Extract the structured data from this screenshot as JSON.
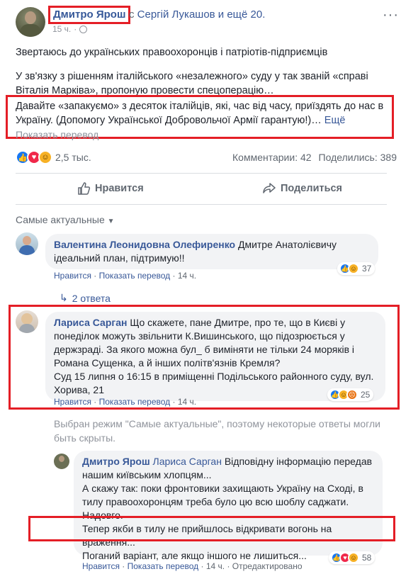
{
  "post": {
    "author": "Дмитро Ярош",
    "with_text": "с",
    "with_people": "Сергій Лукашов и ещё 20.",
    "time": "15 ч.",
    "more_menu": "···",
    "p1": "Звертаюсь до українських правоохоронців і патріотів-підприємців",
    "p2": "У зв'язку з рішенням італійського «незалежного» суду у так званій «справі Віталія Марківа», пропоную провести спецоперацію…",
    "p3": "Давайте «запакуємо» з десяток італійців, які, час від часу, приїздять до нас в Україну. (Допомогу Української Добровольчої Армії гарантую!)…",
    "p3_more": "Ещё",
    "translate": "Показать перевод",
    "reactions_count": "2,5 тыс.",
    "comments_count": "Комментарии: 42",
    "shares_count": "Поделились: 389",
    "reaction_icons": [
      "like-icon",
      "love-icon",
      "wow-icon"
    ]
  },
  "actions": {
    "like": "Нравится",
    "share": "Поделиться"
  },
  "sort": {
    "label": "Самые актуальные"
  },
  "comments": [
    {
      "name": "Валентина Леонидовна Олефиренко",
      "text": "Дмитре Анатолієвичу ідеальний план, підтримую!!",
      "like": "Нравится",
      "translate": "Показать перевод",
      "time": "14 ч.",
      "reactions": "37"
    },
    {
      "replies": "2 ответа"
    },
    {
      "name": "Лариса Сарган",
      "text": "Що скажете, пане Дмитре, про те, що в Києві у понеділок можуть звільнити К.Вишинського, що підозрюється у держзраді. За якого можна бул_ б виміняти не тільки 24 моряків і Романа Сущенка, а й інших політв'язнів Кремля?",
      "text2": "Суд 15 липня о 16:15 в приміщенні Подільського районного суду, вул. Хорива, 21",
      "like": "Нравится",
      "translate": "Показать перевод",
      "time": "14 ч.",
      "reactions": "25"
    }
  ],
  "mode_note": "Выбран режим \"Самые актуальные\", поэтому некоторые ответы могли быть скрыты.",
  "reply": {
    "name": "Дмитро Ярош",
    "mention": "Лариса Сарган",
    "line1": "Відповідну інформацію передав нашим київським хлопцям...",
    "line2": "А скажу так: поки фронтовики захищають Україну на Сході, в тилу правоохоронцям треба було цю всю шоблу саджати. Надовго.",
    "line3": "Тепер якби в тилу не прийшлось відкривати вогонь на враження...",
    "line4": "Поганий варіант, але якщо іншого не лишиться...",
    "like": "Нравится",
    "translate": "Показать перевод",
    "time": "14 ч.",
    "edited": "Отредактировано",
    "reactions": "58"
  },
  "colors": {
    "link": "#385898",
    "highlight": "#e41e26",
    "like": "#1877f2"
  }
}
